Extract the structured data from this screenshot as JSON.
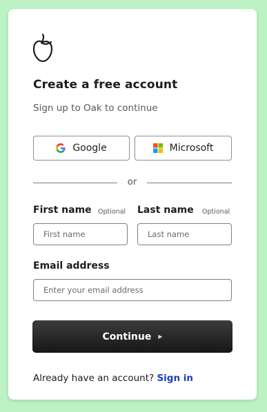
{
  "header": {
    "logo": "oak-acorn-logo",
    "title": "Create a free account",
    "subtitle": "Sign up to Oak to continue"
  },
  "social": {
    "google_label": "Google",
    "microsoft_label": "Microsoft"
  },
  "divider_text": "or",
  "form": {
    "first_name_label": "First name",
    "first_name_optional": "Optional",
    "first_name_placeholder": "First name",
    "first_name_value": "",
    "last_name_label": "Last name",
    "last_name_optional": "Optional",
    "last_name_placeholder": "Last name",
    "last_name_value": "",
    "email_label": "Email address",
    "email_placeholder": "Enter your email address",
    "email_value": ""
  },
  "continue_label": "Continue",
  "continue_icon": "play-arrow-icon",
  "footer": {
    "prompt": "Already have an account?",
    "signin_label": "Sign in"
  },
  "colors": {
    "page_background": "#bdf2c4",
    "button_dark": "#1e1e1e",
    "link": "#1a3ec2"
  }
}
